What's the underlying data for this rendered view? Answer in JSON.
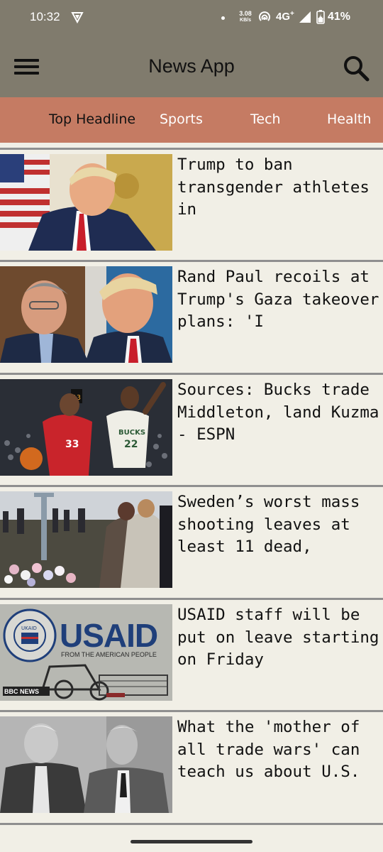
{
  "status_bar": {
    "time": "10:32",
    "net_speed": "3.08",
    "net_speed_unit": "KB/s",
    "network": "4G",
    "network_sup": "+",
    "battery": "41%"
  },
  "app_bar": {
    "title": "News App",
    "menu_icon": "hamburger-menu-icon",
    "search_icon": "search-icon"
  },
  "tabs": [
    {
      "label": "Top Headline"
    },
    {
      "label": "Sports"
    },
    {
      "label": "Tech"
    },
    {
      "label": "Health"
    }
  ],
  "articles": [
    {
      "headline": "Trump to ban transgender athletes in"
    },
    {
      "headline": "Rand Paul recoils at Trump's Gaza takeover plans: 'I"
    },
    {
      "headline": "Sources: Bucks trade Middleton, land Kuzma - ESPN"
    },
    {
      "headline": "Sweden’s worst mass shooting leaves at least 11 dead,"
    },
    {
      "headline": "USAID staff will be put on leave starting on Friday"
    },
    {
      "headline": "What the 'mother of all trade wars' can teach us about U.S."
    }
  ],
  "thumb_captions": {
    "usaid_main": "USAID",
    "usaid_sub": "FROM THE AMERICAN PEOPLE",
    "usaid_seal": "UKAID",
    "bbc": "BBC NEWS",
    "jersey_number": "33",
    "bucks_text": "BUCKS",
    "bucks_number": "22"
  },
  "colors": {
    "app_bar": "#807b6d",
    "tabs_bg": "#c57b63",
    "page_bg": "#f1efe6",
    "divider": "#8f8f8f"
  }
}
